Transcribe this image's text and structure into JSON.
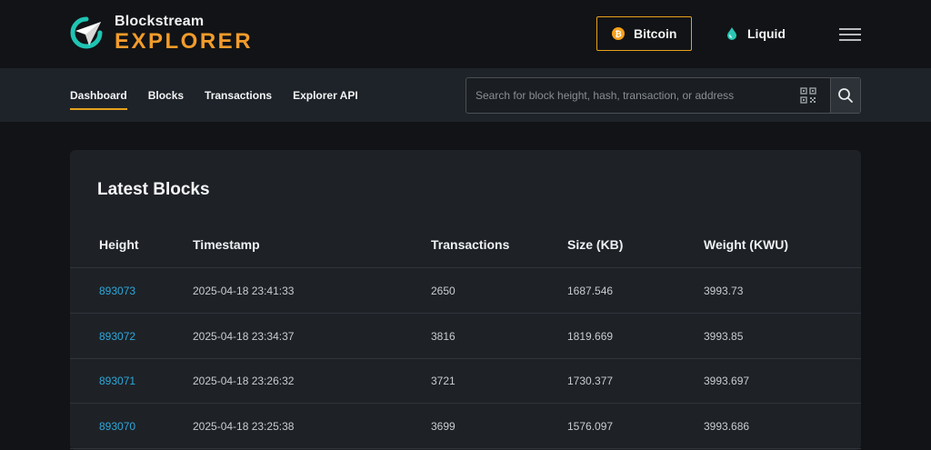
{
  "header": {
    "brand": "Blockstream",
    "product": "EXPLORER",
    "networks": [
      {
        "label": "Bitcoin",
        "icon": "bitcoin-coin-icon",
        "selected": true
      },
      {
        "label": "Liquid",
        "icon": "liquid-drop-icon",
        "selected": false
      }
    ],
    "menu_icon": "hamburger-menu-icon"
  },
  "nav": {
    "tabs": [
      {
        "label": "Dashboard",
        "active": true
      },
      {
        "label": "Blocks",
        "active": false
      },
      {
        "label": "Transactions",
        "active": false
      },
      {
        "label": "Explorer API",
        "active": false
      }
    ],
    "search": {
      "placeholder": "Search for block height, hash, transaction, or address",
      "value": ""
    }
  },
  "latest_blocks": {
    "title": "Latest Blocks",
    "columns": [
      "Height",
      "Timestamp",
      "Transactions",
      "Size (KB)",
      "Weight (KWU)"
    ],
    "rows": [
      {
        "height": "893073",
        "timestamp": "2025-04-18 23:41:33",
        "transactions": "2650",
        "size": "1687.546",
        "weight": "3993.73"
      },
      {
        "height": "893072",
        "timestamp": "2025-04-18 23:34:37",
        "transactions": "3816",
        "size": "1819.669",
        "weight": "3993.85"
      },
      {
        "height": "893071",
        "timestamp": "2025-04-18 23:26:32",
        "transactions": "3721",
        "size": "1730.377",
        "weight": "3993.697"
      },
      {
        "height": "893070",
        "timestamp": "2025-04-18 23:25:38",
        "transactions": "3699",
        "size": "1576.097",
        "weight": "3993.686"
      }
    ]
  },
  "colors": {
    "accent": "#e6a11d",
    "brand_orange": "#f39c2b",
    "link": "#2ea8db",
    "background": "#111316",
    "panel": "#1e2227"
  }
}
